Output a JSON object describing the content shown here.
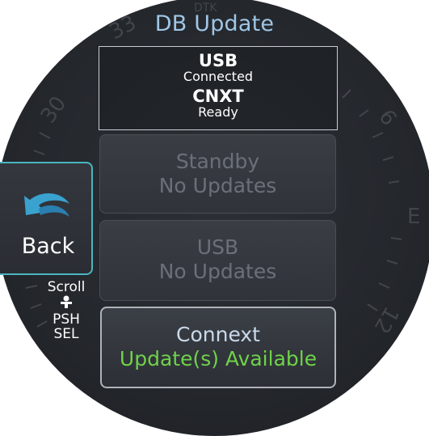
{
  "title": "DB Update",
  "status": {
    "usb_label": "USB",
    "usb_state": "Connected",
    "cnxt_label": "CNXT",
    "cnxt_state": "Ready"
  },
  "buttons": [
    {
      "line1": "Standby",
      "line2": "No Updates",
      "enabled": false
    },
    {
      "line1": "USB",
      "line2": "No Updates",
      "enabled": false
    },
    {
      "line1": "Connext",
      "line2": "Update(s) Available",
      "enabled": true
    }
  ],
  "back_label": "Back",
  "knob_hints": {
    "scroll": "Scroll",
    "push": "PSH",
    "select": "SEL"
  },
  "compass_labels": [
    "30",
    "33",
    "DTK",
    "6",
    "E",
    "12"
  ],
  "colors": {
    "accent_cyan": "#4ab6c0",
    "title_blue": "#9fc6e6",
    "available_green": "#6fd24a"
  }
}
